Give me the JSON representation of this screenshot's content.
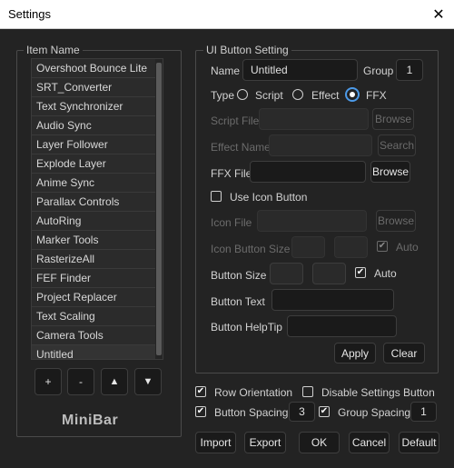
{
  "window": {
    "title": "Settings",
    "close_glyph": "✕"
  },
  "item_panel": {
    "legend": "Item Name",
    "items": [
      "Overshoot Bounce Lite",
      "SRT_Converter",
      "Text Synchronizer",
      "Audio Sync",
      "Layer Follower",
      "Explode Layer",
      "Anime Sync",
      "Parallax Controls",
      "AutoRing",
      "Marker Tools",
      "RasterizeAll",
      "FEF Finder",
      "Project Replacer",
      "Text Scaling",
      "Camera Tools",
      "Untitled"
    ],
    "selected_index": 15,
    "controls": {
      "add": "+",
      "remove": "-",
      "up": "▲",
      "down": "▼"
    },
    "logo": "MiniBar"
  },
  "button_setting": {
    "legend": "UI Button Setting",
    "name_label": "Name",
    "name_value": "Untitled",
    "group_label": "Group",
    "group_value": "1",
    "type_label": "Type",
    "type_options": [
      "Script",
      "Effect",
      "FFX"
    ],
    "type_selected": "FFX",
    "script_file_label": "Script File",
    "script_browse": "Browse",
    "effect_name_label": "Effect Name",
    "effect_search": "Search",
    "ffx_file_label": "FFX File",
    "ffx_browse": "Browse",
    "use_icon_label": "Use Icon Button",
    "use_icon_checked": false,
    "icon_file_label": "Icon File",
    "icon_browse": "Browse",
    "icon_size_label": "Icon Button Size",
    "icon_size_auto": "Auto",
    "icon_size_auto_checked": true,
    "button_size_label": "Button Size",
    "button_size_auto": "Auto",
    "button_size_auto_checked": true,
    "button_text_label": "Button Text",
    "button_text_value": "",
    "helptip_label": "Button HelpTip",
    "helptip_value": "",
    "apply": "Apply",
    "clear": "Clear"
  },
  "options": {
    "row_orientation": "Row Orientation",
    "row_orientation_checked": true,
    "disable_settings": "Disable Settings Button",
    "disable_settings_checked": false,
    "button_spacing": "Button Spacing",
    "button_spacing_checked": true,
    "button_spacing_value": "3",
    "group_spacing": "Group Spacing",
    "group_spacing_checked": true,
    "group_spacing_value": "1"
  },
  "footer": {
    "import": "Import",
    "export": "Export",
    "ok": "OK",
    "cancel": "Cancel",
    "default": "Default"
  },
  "check_glyph": "✔",
  "colors": {
    "background": "#232323",
    "accent": "#4c9ae8",
    "field": "#1a1a1a"
  }
}
